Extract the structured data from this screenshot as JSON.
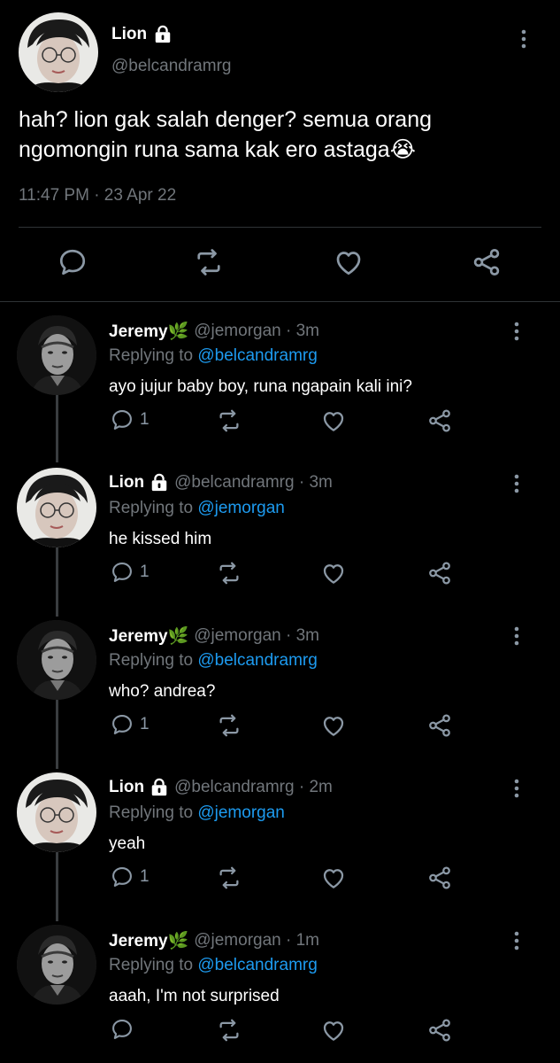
{
  "main": {
    "name": "Lion",
    "handle": "@belcandramrg",
    "text": "hah? lion gak salah denger? semua orang ngomongin runa sama kak ero astaga😭",
    "timestamp": "11:47 PM · 23 Apr 22"
  },
  "replies": [
    {
      "name": "Jeremy🌿",
      "handle": "@jemorgan · 3m",
      "replying_label": "Replying to ",
      "replying_to": "@belcandramrg",
      "text": "ayo jujur baby boy, runa ngapain kali ini?",
      "reply_count": "1",
      "avatar": "jeremy"
    },
    {
      "name": "Lion",
      "handle": "@belcandramrg · 3m",
      "replying_label": "Replying to ",
      "replying_to": "@jemorgan",
      "text": "he kissed him",
      "reply_count": "1",
      "avatar": "lion"
    },
    {
      "name": "Jeremy🌿",
      "handle": "@jemorgan · 3m",
      "replying_label": "Replying to ",
      "replying_to": "@belcandramrg",
      "text": "who? andrea?",
      "reply_count": "1",
      "avatar": "jeremy"
    },
    {
      "name": "Lion",
      "handle": "@belcandramrg · 2m",
      "replying_label": "Replying to ",
      "replying_to": "@jemorgan",
      "text": "yeah",
      "reply_count": "1",
      "avatar": "lion"
    },
    {
      "name": "Jeremy🌿",
      "handle": "@jemorgan · 1m",
      "replying_label": "Replying to ",
      "replying_to": "@belcandramrg",
      "text": "aaah, I'm not surprised",
      "reply_count": "",
      "avatar": "jeremy"
    }
  ],
  "icons": {
    "reply": "reply-icon",
    "retweet": "retweet-icon",
    "like": "heart-icon",
    "share": "share-icon",
    "more": "more-vertical-icon",
    "lock": "lock-icon"
  },
  "colors": {
    "background": "#000000",
    "text": "#ffffff",
    "secondary": "#71767b",
    "link": "#1d9bf0",
    "icon": "#8b98a5"
  }
}
